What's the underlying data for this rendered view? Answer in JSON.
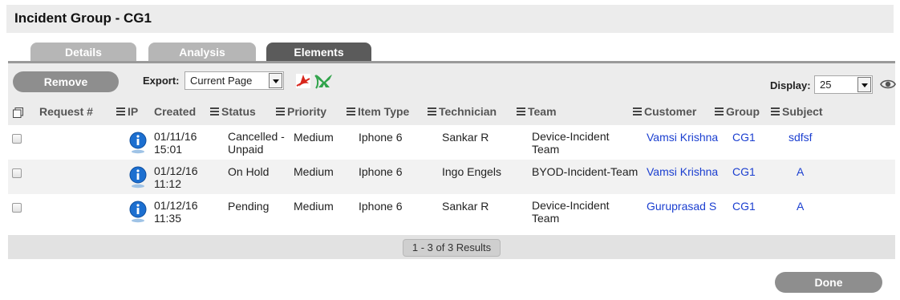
{
  "page": {
    "title": "Incident Group - CG1"
  },
  "tabs": [
    {
      "label": "Details",
      "active": false
    },
    {
      "label": "Analysis",
      "active": false
    },
    {
      "label": "Elements",
      "active": true
    }
  ],
  "toolbar": {
    "remove_label": "Remove",
    "export_label": "Export:",
    "export_value": "Current Page",
    "display_label": "Display:",
    "display_value": "25",
    "icons": [
      "pdf-icon",
      "excel-icon",
      "eye-icon"
    ]
  },
  "grid": {
    "columns": [
      "Request #",
      "IP",
      "Created",
      "Status",
      "Priority",
      "Item Type",
      "Technician",
      "Team",
      "Customer",
      "Group",
      "Subject"
    ],
    "rows": [
      {
        "created": [
          "01/11/16",
          "15:01"
        ],
        "status": [
          "Cancelled -",
          "Unpaid"
        ],
        "priority": "Medium",
        "item_type": "Iphone 6",
        "technician": "Sankar R",
        "team": [
          "Device-Incident",
          "Team"
        ],
        "customer": "Vamsi Krishna",
        "group": "CG1",
        "subject": "sdfsf"
      },
      {
        "created": [
          "01/12/16",
          "11:12"
        ],
        "status": [
          "On Hold",
          ""
        ],
        "priority": "Medium",
        "item_type": "Iphone 6",
        "technician": "Ingo Engels",
        "team": [
          "BYOD-Incident-Team",
          ""
        ],
        "customer": "Vamsi Krishna",
        "group": "CG1",
        "subject": "A"
      },
      {
        "created": [
          "01/12/16",
          "11:35"
        ],
        "status": [
          "Pending",
          ""
        ],
        "priority": "Medium",
        "item_type": "Iphone 6",
        "technician": "Sankar R",
        "team": [
          "Device-Incident",
          "Team"
        ],
        "customer": "Guruprasad S",
        "group": "CG1",
        "subject": "A"
      }
    ],
    "results_text": "1 - 3 of 3 Results"
  },
  "footer": {
    "done_label": "Done"
  },
  "colors": {
    "link": "#1b3fd0",
    "tab_active": "#5b5b5b",
    "tab_inactive": "#b6b6b6",
    "button": "#8e8e8e"
  }
}
